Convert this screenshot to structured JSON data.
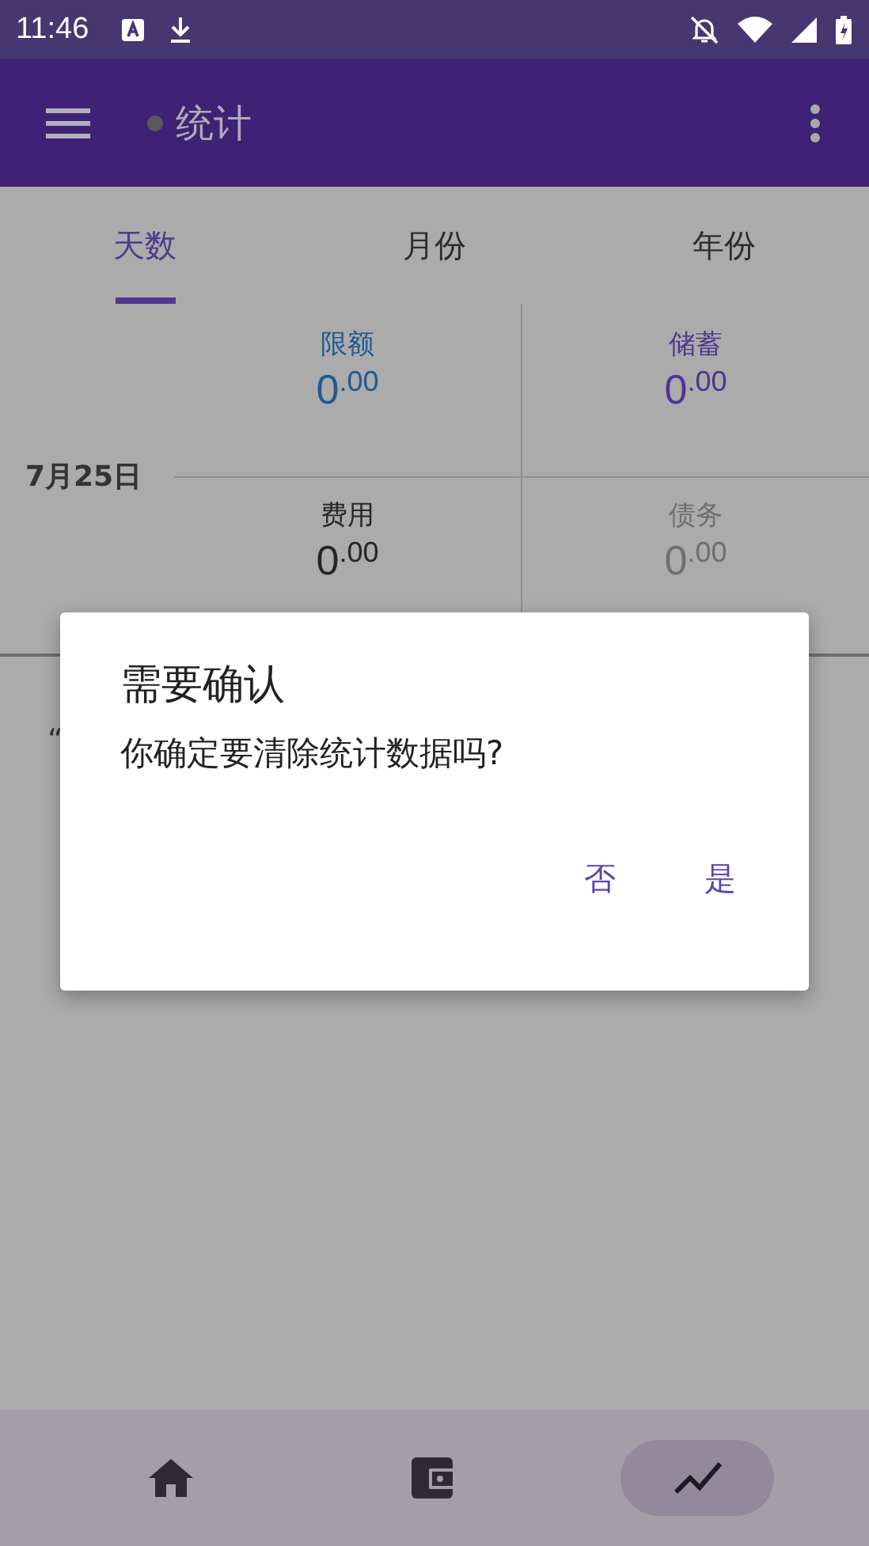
{
  "status_bar": {
    "time": "11:46"
  },
  "app_bar": {
    "title": "统计"
  },
  "tabs": [
    {
      "label": "天数",
      "selected": true
    },
    {
      "label": "月份",
      "selected": false
    },
    {
      "label": "年份",
      "selected": false
    }
  ],
  "date": "7月25日",
  "stats": [
    {
      "label": "限额",
      "value": "0$^{.00}$",
      "color": "#1f5a92"
    },
    {
      "label": "储蓄",
      "value": "0$^{.00}$",
      "color": "#4f3592"
    },
    {
      "label": "费用",
      "value": "0$^{.00}$",
      "color": "#262626"
    },
    {
      "label": "债务",
      "value": "0$^{.00}$",
      "color": "#6e6e6e"
    }
  ],
  "background_text": [
    "“"
  ],
  "dialog": {
    "title": "需要确认",
    "message": "你确定要清除统计数据吗?",
    "buttons": [
      "否",
      "是"
    ]
  },
  "bottom_nav": [
    {
      "kind": "home",
      "selected": false
    },
    {
      "kind": "wallet",
      "selected": false
    },
    {
      "kind": "chart",
      "selected": true
    }
  ]
}
